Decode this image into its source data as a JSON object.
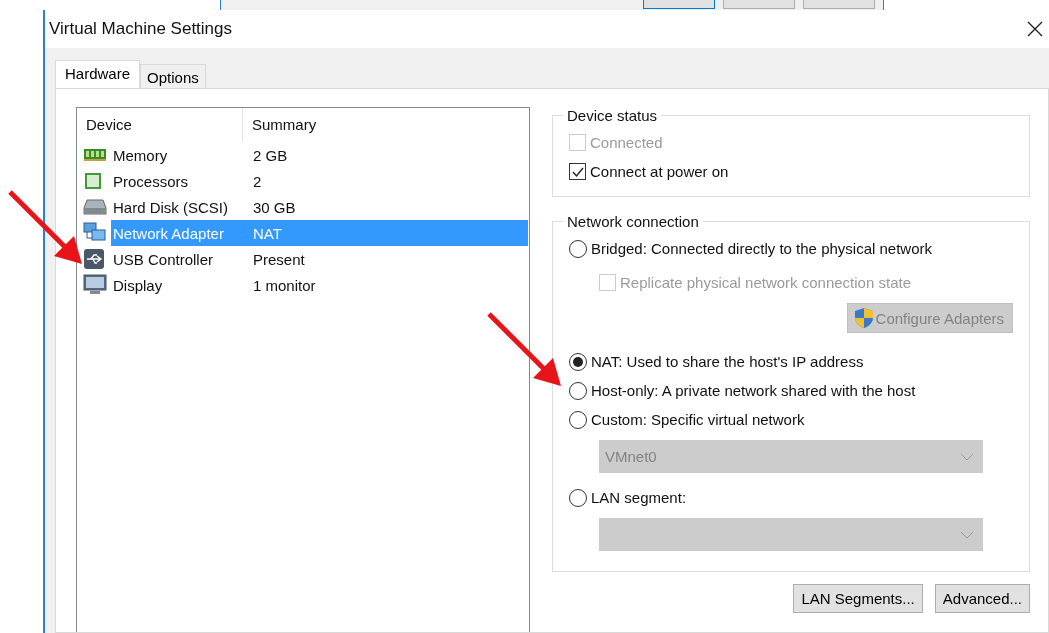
{
  "window": {
    "title": "Virtual Machine Settings"
  },
  "tabs": [
    {
      "label": "Hardware",
      "selected": true
    },
    {
      "label": "Options",
      "selected": false
    }
  ],
  "devices": {
    "columns": [
      "Device",
      "Summary"
    ],
    "rows": [
      {
        "kind": "memory",
        "device": "Memory",
        "summary": "2 GB",
        "selected": false
      },
      {
        "kind": "processor",
        "device": "Processors",
        "summary": "2",
        "selected": false
      },
      {
        "kind": "disk",
        "device": "Hard Disk (SCSI)",
        "summary": "30 GB",
        "selected": false
      },
      {
        "kind": "network",
        "device": "Network Adapter",
        "summary": "NAT",
        "selected": true
      },
      {
        "kind": "usb",
        "device": "USB Controller",
        "summary": "Present",
        "selected": false
      },
      {
        "kind": "display",
        "device": "Display",
        "summary": "1 monitor",
        "selected": false
      }
    ]
  },
  "device_status": {
    "title": "Device status",
    "options": [
      {
        "label": "Connected",
        "checked": false,
        "disabled": true
      },
      {
        "label": "Connect at power on",
        "checked": true,
        "disabled": false
      }
    ]
  },
  "network_connection": {
    "title": "Network connection",
    "items": [
      {
        "kind": "radio",
        "label": "Bridged: Connected directly to the physical network",
        "selected": false
      },
      {
        "kind": "checkbox",
        "label": "Replicate physical network connection state",
        "checked": false,
        "disabled": true
      },
      {
        "kind": "button",
        "label": "Configure Adapters",
        "disabled": true
      },
      {
        "kind": "radio",
        "label": "NAT: Used to share the host's IP address",
        "selected": true
      },
      {
        "kind": "radio",
        "label": "Host-only: A private network shared with the host",
        "selected": false
      },
      {
        "kind": "radio",
        "label": "Custom: Specific virtual network",
        "selected": false
      },
      {
        "kind": "dropdown",
        "value": "VMnet0",
        "disabled": true
      },
      {
        "kind": "radio",
        "label": "LAN segment:",
        "selected": false
      },
      {
        "kind": "dropdown",
        "value": "",
        "disabled": true
      }
    ]
  },
  "buttons": [
    "LAN Segments...",
    "Advanced..."
  ]
}
